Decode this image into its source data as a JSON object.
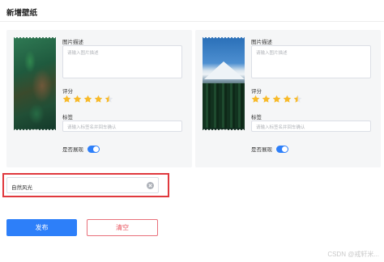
{
  "header": {
    "title": "新增壁纸"
  },
  "cards": [
    {
      "image": "forest-aerial",
      "desc_label": "图片描述",
      "desc_placeholder": "请输入图片描述",
      "rating_label": "评分",
      "rating": 4.5,
      "rating_max": 5,
      "tag_label": "标签",
      "tag_placeholder": "请输入标签名并回车确认",
      "show_label": "是否展现",
      "show_on": true
    },
    {
      "image": "snow-mountain",
      "desc_label": "图片描述",
      "desc_placeholder": "请输入图片描述",
      "rating_label": "评分",
      "rating": 4.5,
      "rating_max": 5,
      "tag_label": "标签",
      "tag_placeholder": "请输入标签名并回车确认",
      "show_label": "是否展现",
      "show_on": true
    }
  ],
  "category": {
    "value": "自然风光"
  },
  "actions": {
    "publish": "发布",
    "clear": "清空"
  },
  "watermark": "CSDN @戒轩米...",
  "colors": {
    "accent": "#2d7ff9",
    "star": "#f7ba2a",
    "danger": "#e8505b",
    "highlight": "#e0393e"
  }
}
